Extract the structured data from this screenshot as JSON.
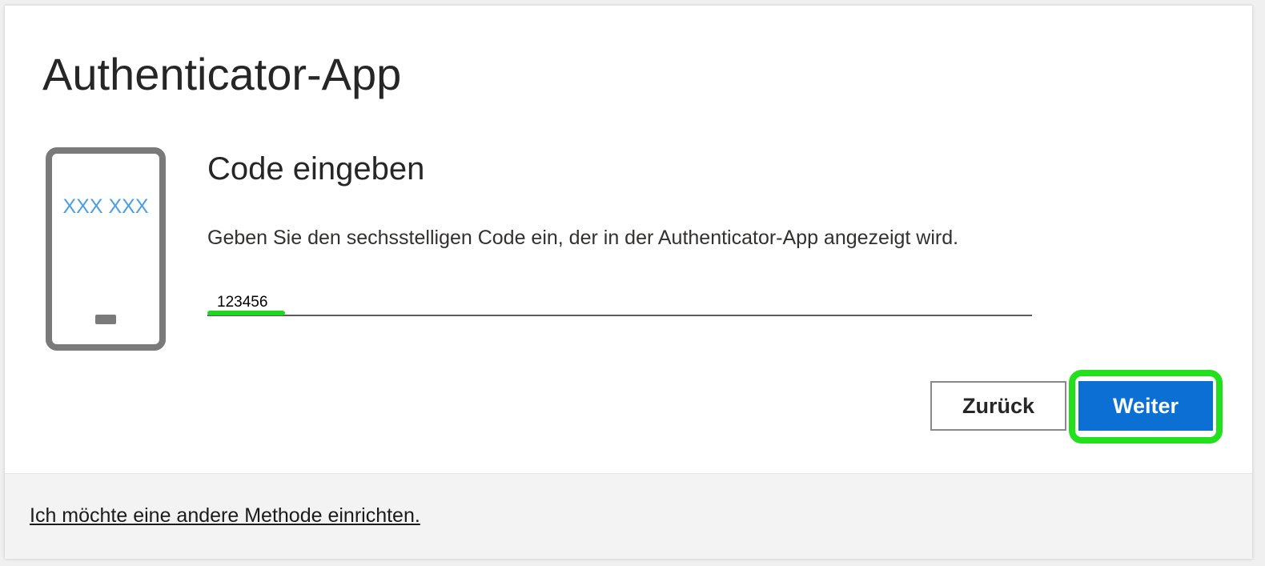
{
  "dialog": {
    "title": "Authenticator-App",
    "subtitle": "Code eingeben",
    "description": "Geben Sie den sechsstelligen Code ein, der in der Authenticator-App angezeigt wird.",
    "phone_illustration": {
      "icon": "phone-icon",
      "screen_text": "XXX XXX",
      "screen_text_color": "#4a9fe8"
    },
    "code_input": {
      "value": "123456",
      "placeholder": ""
    },
    "buttons": {
      "back_label": "Zurück",
      "next_label": "Weiter"
    },
    "accent_color": "#0b6fd3",
    "annotation_color": "#22e01c"
  },
  "footer": {
    "link_label": "Ich möchte eine andere Methode einrichten."
  }
}
